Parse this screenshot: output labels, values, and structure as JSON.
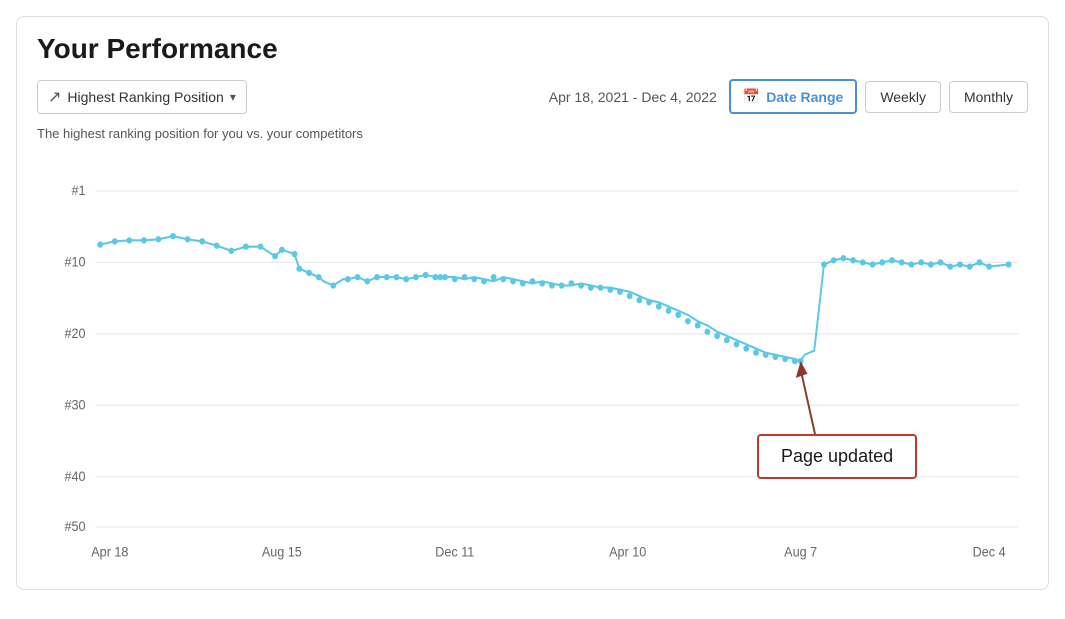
{
  "page": {
    "title": "Your Performance",
    "subtitle": "The highest ranking position for you vs. your competitors"
  },
  "toolbar": {
    "metric_label": "Highest Ranking Position",
    "date_range_text": "Apr 18, 2021 - Dec 4, 2022",
    "date_range_btn": "Date Range",
    "weekly_btn": "Weekly",
    "monthly_btn": "Monthly"
  },
  "chart": {
    "y_labels": [
      "#1",
      "#10",
      "#20",
      "#30",
      "#40",
      "#50"
    ],
    "x_labels": [
      "Apr 18",
      "Aug 15",
      "Dec 11",
      "Apr 10",
      "Aug 7",
      "Dec 4"
    ],
    "annotation": "Page updated"
  }
}
